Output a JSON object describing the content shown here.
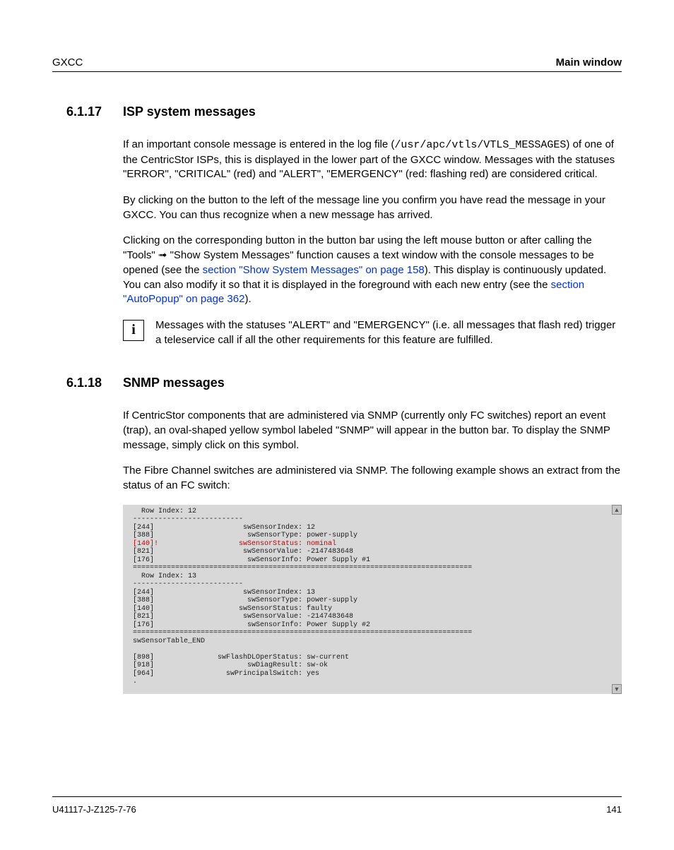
{
  "header": {
    "left": "GXCC",
    "right": "Main window"
  },
  "sections": {
    "isp": {
      "number": "6.1.17",
      "title": "ISP system messages",
      "p1_a": "If an important console message is entered in the log file (",
      "p1_path": "/usr/apc/vtls/VTLS_MESSAGES",
      "p1_b": ") of one of the CentricStor ISPs, this is displayed in the lower part of the GXCC window. Messages with the statuses \"ERROR\", \"CRITICAL\" (red) and \"ALERT\", \"EMERGENCY\" (red: flashing red) are considered critical.",
      "p2": "By clicking on the button to the left of the message line you confirm you have read the message in your GXCC. You can thus recognize when a new message has arrived.",
      "p3_a": "Clicking on the corresponding button in the button bar using the left mouse button or after calling the \"Tools\" ➟ \"Show System Messages\" function causes a text window with the console messages to be opened (see the ",
      "p3_link1": "section \"Show System Messages\" on page 158",
      "p3_b": "). This display is continuously updated. You can also modify it so that it is displayed in the foreground with each new entry (see the ",
      "p3_link2": "section \"AutoPopup\" on page 362",
      "p3_c": ").",
      "info_icon": "i",
      "info": "Messages with the statuses \"ALERT\" and \"EMERGENCY\" (i.e. all messages that flash red) trigger a teleservice call if all the other requirements for this feature are fulfilled."
    },
    "snmp": {
      "number": "6.1.18",
      "title": "SNMP messages",
      "p1": "If CentricStor components that are administered via SNMP (currently only FC switches) report an event (trap), an oval-shaped yellow symbol labeled \"SNMP\" will appear in the button bar. To display the SNMP message, simply click on this symbol.",
      "p2": "The Fibre Channel switches are administered via SNMP. The following example shows an extract from the status of an FC switch:",
      "console_pre": "   Row Index: 12\n --------------------------\n [244]                     swSensorIndex: 12\n [388]                      swSensorType: power-supply",
      "console_red": " [140]!                   swSensorStatus: nominal",
      "console_post": " [821]                     swSensorValue: -2147483648\n [176]                      swSensorInfo: Power Supply #1\n ================================================================================\n   Row Index: 13\n --------------------------\n [244]                     swSensorIndex: 13\n [388]                      swSensorType: power-supply\n [140]                    swSensorStatus: faulty\n [821]                     swSensorValue: -2147483648\n [176]                      swSensorInfo: Power Supply #2\n ================================================================================\n swSensorTable_END\n\n [898]               swFlashDLOperStatus: sw-current\n [918]                      swDiagResult: sw-ok\n [964]                 swPrincipalSwitch: yes\n ."
    }
  },
  "footer": {
    "left": "U41117-J-Z125-7-76",
    "right": "141"
  }
}
